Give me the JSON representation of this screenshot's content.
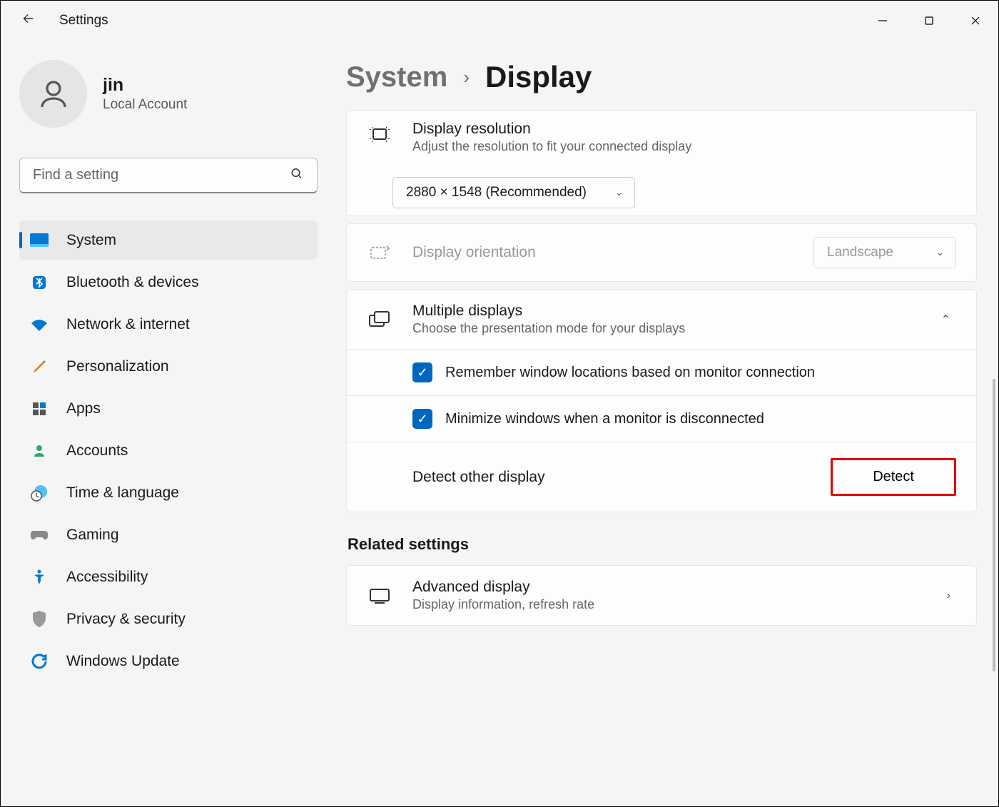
{
  "app": {
    "title": "Settings"
  },
  "profile": {
    "name": "jin",
    "type": "Local Account"
  },
  "search": {
    "placeholder": "Find a setting"
  },
  "nav": [
    {
      "label": "System",
      "active": true
    },
    {
      "label": "Bluetooth & devices"
    },
    {
      "label": "Network & internet"
    },
    {
      "label": "Personalization"
    },
    {
      "label": "Apps"
    },
    {
      "label": "Accounts"
    },
    {
      "label": "Time & language"
    },
    {
      "label": "Gaming"
    },
    {
      "label": "Accessibility"
    },
    {
      "label": "Privacy & security"
    },
    {
      "label": "Windows Update"
    }
  ],
  "breadcrumb": {
    "parent": "System",
    "current": "Display"
  },
  "resolution": {
    "title": "Display resolution",
    "sub": "Adjust the resolution to fit your connected display",
    "value": "2880 × 1548 (Recommended)"
  },
  "orientation": {
    "title": "Display orientation",
    "value": "Landscape"
  },
  "multiple": {
    "title": "Multiple displays",
    "sub": "Choose the presentation mode for your displays",
    "opt1": "Remember window locations based on monitor connection",
    "opt2": "Minimize windows when a monitor is disconnected",
    "detect_label": "Detect other display",
    "detect_btn": "Detect"
  },
  "related": {
    "heading": "Related settings",
    "advanced_title": "Advanced display",
    "advanced_sub": "Display information, refresh rate"
  }
}
